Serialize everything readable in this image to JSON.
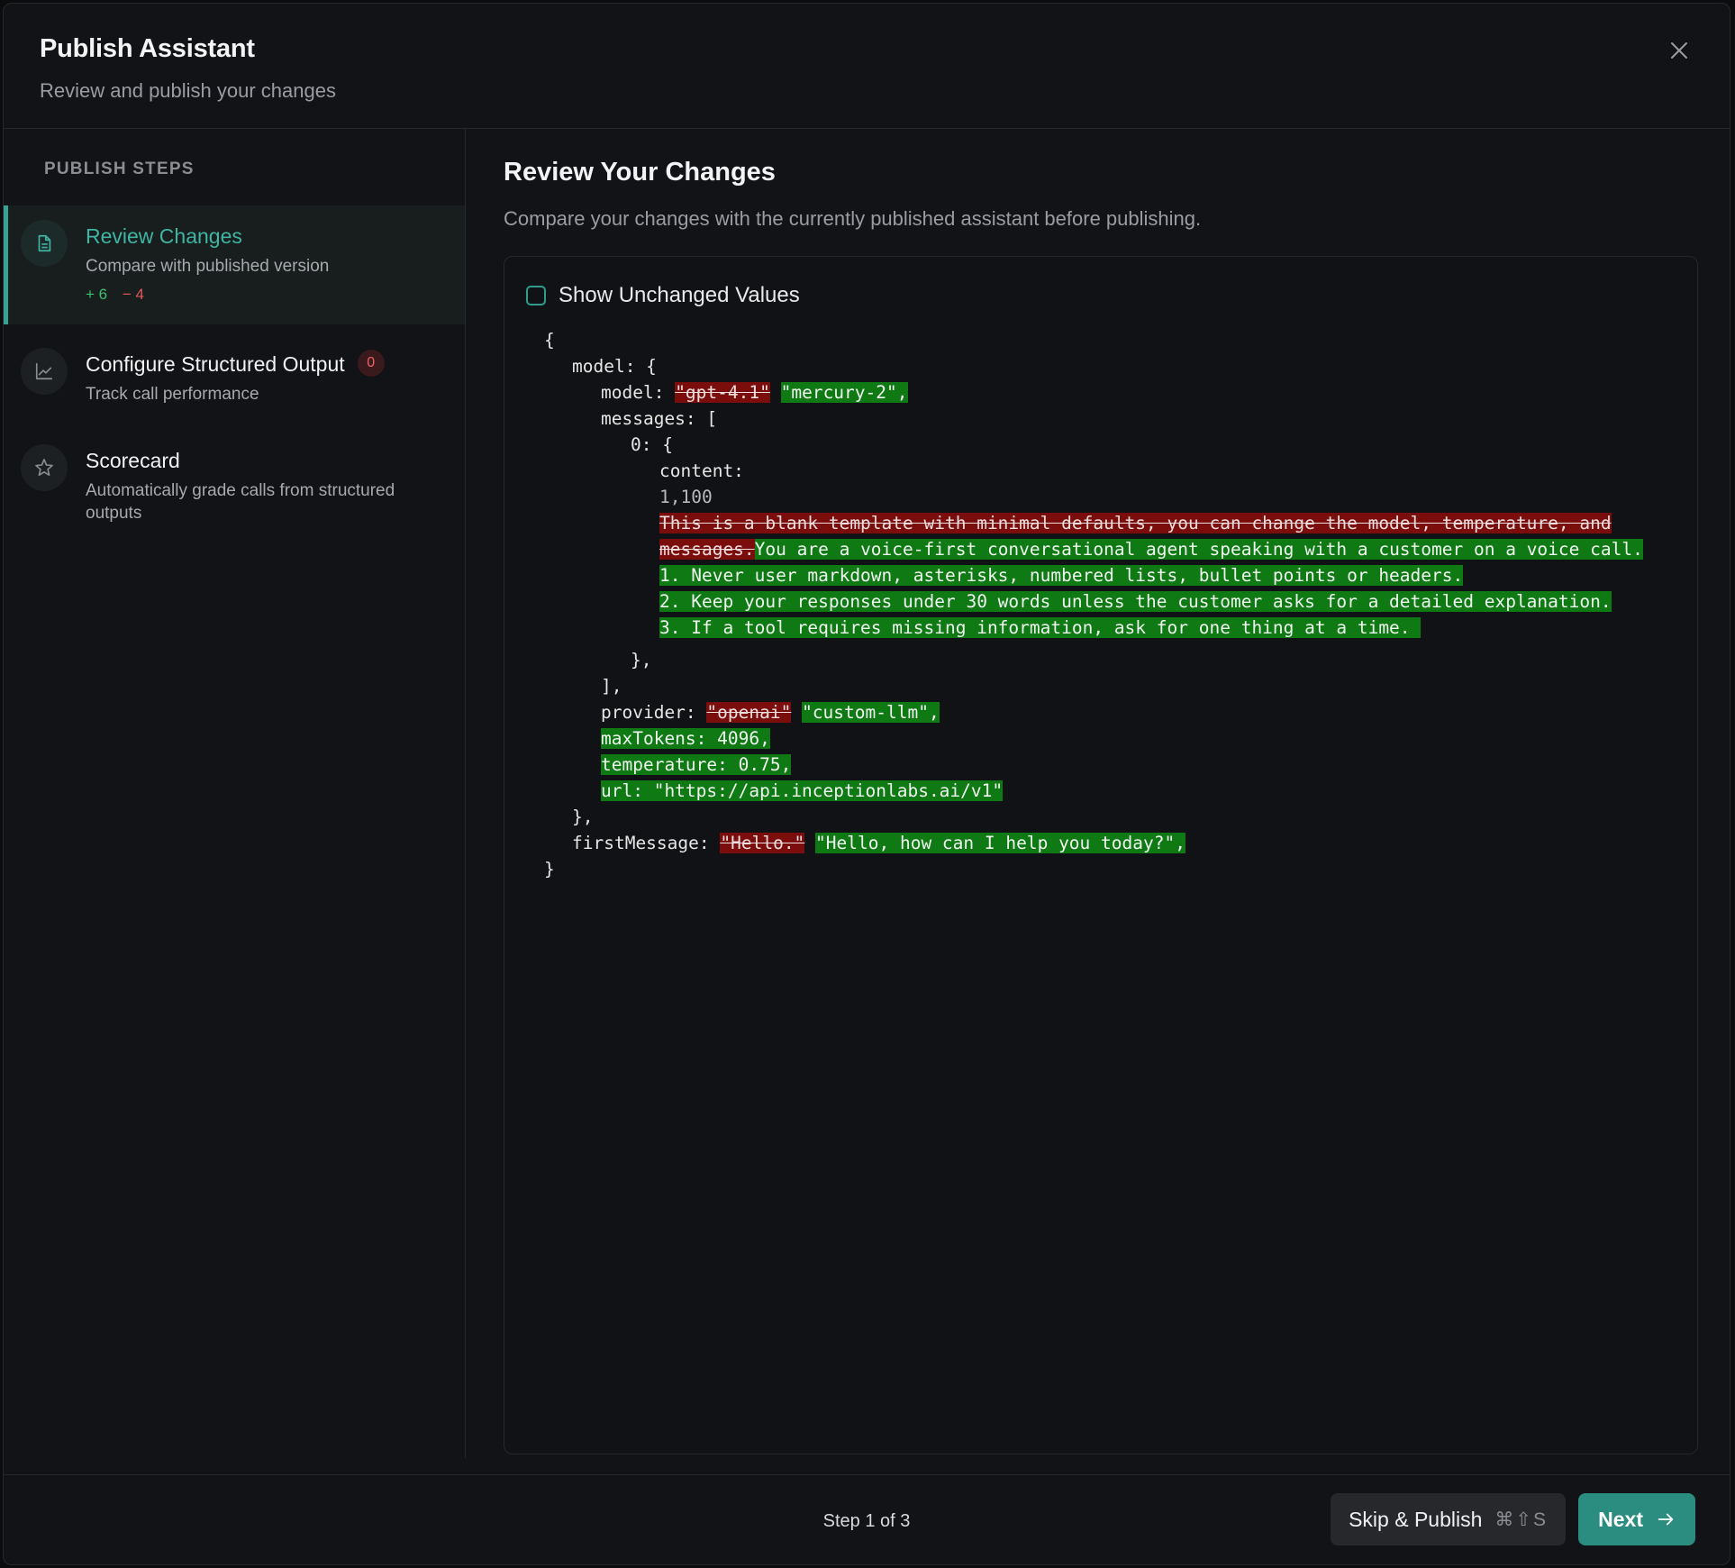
{
  "header": {
    "title": "Publish Assistant",
    "subtitle": "Review and publish your changes"
  },
  "sidebar": {
    "heading": "PUBLISH STEPS",
    "steps": [
      {
        "title": "Review Changes",
        "description": "Compare with published version",
        "added": "+ 6",
        "removed": "− 4",
        "icon": "document-icon",
        "active": true
      },
      {
        "title": "Configure Structured Output",
        "description": "Track call performance",
        "badge": "0",
        "icon": "chart-line-icon"
      },
      {
        "title": "Scorecard",
        "description": "Automatically grade calls from structured outputs",
        "icon": "star-icon"
      }
    ]
  },
  "main": {
    "title": "Review Your Changes",
    "description": "Compare your changes with the currently published assistant before publishing.",
    "show_unchanged_label": "Show Unchanged Values",
    "show_unchanged_checked": false
  },
  "diff": {
    "open_brace": "{",
    "model_key": "model: {",
    "model_model_key": "model: ",
    "model_old": "\"gpt-4.1\"",
    "model_new": "\"mercury-2\",",
    "messages_key": "messages: [",
    "index_key": "0: {",
    "content_key": "content:",
    "content_range": "1,100",
    "content_old_1": "This is a blank template with minimal defaults, you can change the model, temperature, and",
    "content_old_2": "messages.",
    "content_new_1": "You are a voice-first conversational agent speaking with a customer on a voice call.",
    "content_new_2": "1. Never user markdown, asterisks, numbered lists, bullet points or headers.",
    "content_new_3": "2. Keep your responses under 30 words unless the customer asks for a detailed explanation.",
    "content_new_4": "3. If a tool requires missing information, ask for one thing at a time. ",
    "close_obj": "},",
    "close_arr": "],",
    "provider_key": "provider: ",
    "provider_old": "\"openai\"",
    "provider_new": "\"custom-llm\",",
    "max_tokens": "maxTokens: 4096,",
    "temperature": "temperature: 0.75,",
    "url": "url: \"https://api.inceptionlabs.ai/v1\"",
    "close_model": "},",
    "first_message_key": "firstMessage: ",
    "first_message_old": "\"Hello.\"",
    "first_message_new": "\"Hello, how can I help you today?\",",
    "close_brace": "}"
  },
  "footer": {
    "step_indicator": "Step 1 of 3",
    "skip_label": "Skip & Publish",
    "skip_shortcut": "⌘⇧S",
    "next_label": "Next"
  },
  "colors": {
    "accent": "#2a8d80",
    "accent_text": "#3fb5a2",
    "diff_removed": "#7c0d0d",
    "diff_added": "#0f7a14",
    "badge_red": "#f06262"
  }
}
